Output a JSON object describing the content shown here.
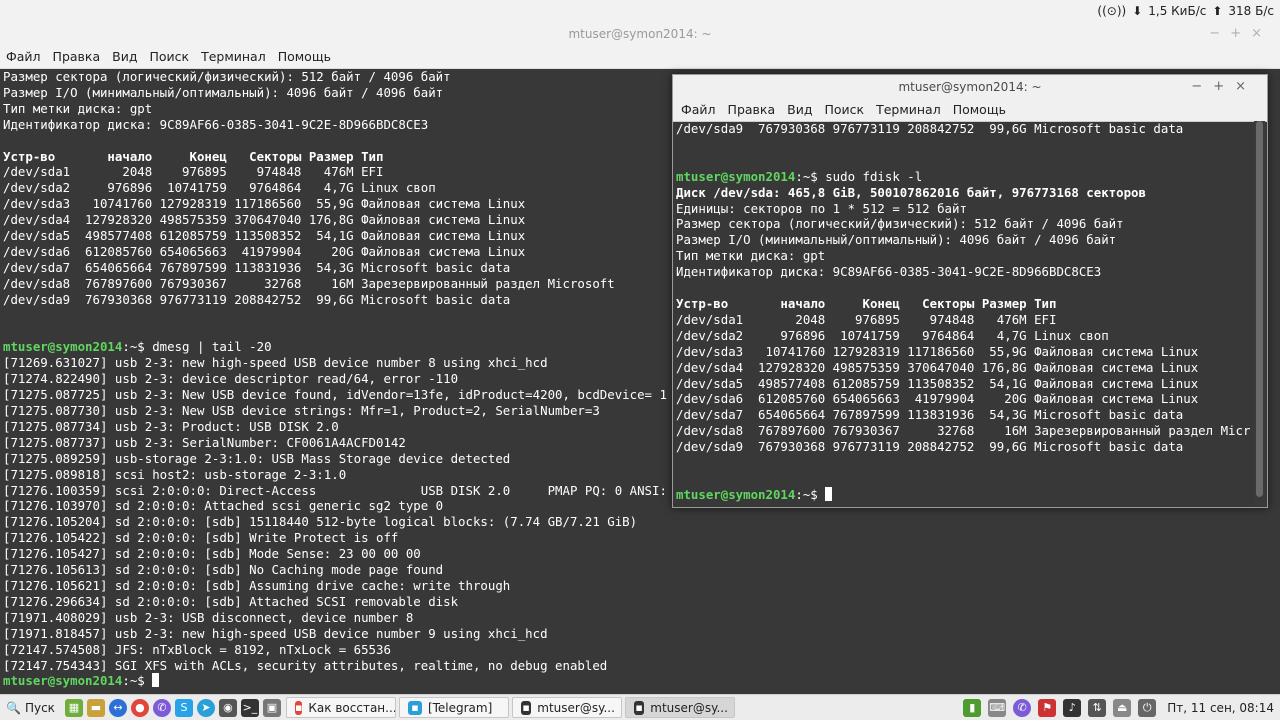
{
  "top_status": {
    "net_icon": "network-icon",
    "down_speed": "1,5 КиБ/с",
    "up_speed": "318 Б/с"
  },
  "win1": {
    "title": "mtuser@symon2014: ~",
    "menu": [
      "Файл",
      "Правка",
      "Вид",
      "Поиск",
      "Терминал",
      "Помощь"
    ],
    "lines_head": [
      "Размер сектора (логический/физический): 512 байт / 4096 байт",
      "Размер I/O (минимальный/оптимальный): 4096 байт / 4096 байт",
      "Тип метки диска: gpt",
      "Идентификатор диска: 9C89AF66-0385-3041-9C2E-8D966BDC8CE3",
      ""
    ],
    "table_header": "Устр-во       начало     Конец   Секторы Размер Тип",
    "table_rows": [
      "/dev/sda1       2048    976895    974848   476M EFI",
      "/dev/sda2     976896  10741759   9764864   4,7G Linux своп",
      "/dev/sda3   10741760 127928319 117186560  55,9G Файловая система Linux",
      "/dev/sda4  127928320 498575359 370647040 176,8G Файловая система Linux",
      "/dev/sda5  498577408 612085759 113508352  54,1G Файловая система Linux",
      "/dev/sda6  612085760 654065663  41979904    20G Файловая система Linux",
      "/dev/sda7  654065664 767897599 113831936  54,3G Microsoft basic data",
      "/dev/sda8  767897600 767930367     32768    16M Зарезервированный раздел Microsoft",
      "/dev/sda9  767930368 976773119 208842752  99,6G Microsoft basic data"
    ],
    "prompt": "mtuser@symon2014",
    "cmd_dmesg": ":~$ dmesg | tail -20",
    "dmesg": [
      "[71269.631027] usb 2-3: new high-speed USB device number 8 using xhci_hcd",
      "[71274.822490] usb 2-3: device descriptor read/64, error -110",
      "[71275.087725] usb 2-3: New USB device found, idVendor=13fe, idProduct=4200, bcdDevice= 1",
      "[71275.087730] usb 2-3: New USB device strings: Mfr=1, Product=2, SerialNumber=3",
      "[71275.087734] usb 2-3: Product: USB DISK 2.0",
      "[71275.087737] usb 2-3: SerialNumber: CF0061A4ACFD0142",
      "[71275.089259] usb-storage 2-3:1.0: USB Mass Storage device detected",
      "[71275.089818] scsi host2: usb-storage 2-3:1.0",
      "[71276.100359] scsi 2:0:0:0: Direct-Access              USB DISK 2.0     PMAP PQ: 0 ANSI:",
      "[71276.103970] sd 2:0:0:0: Attached scsi generic sg2 type 0",
      "[71276.105204] sd 2:0:0:0: [sdb] 15118440 512-byte logical blocks: (7.74 GB/7.21 GiB)",
      "[71276.105422] sd 2:0:0:0: [sdb] Write Protect is off",
      "[71276.105427] sd 2:0:0:0: [sdb] Mode Sense: 23 00 00 00",
      "[71276.105613] sd 2:0:0:0: [sdb] No Caching mode page found",
      "[71276.105621] sd 2:0:0:0: [sdb] Assuming drive cache: write through",
      "[71276.296634] sd 2:0:0:0: [sdb] Attached SCSI removable disk",
      "[71971.408029] usb 2-3: USB disconnect, device number 8",
      "[71971.818457] usb 2-3: new high-speed USB device number 9 using xhci_hcd",
      "[72147.574508] JFS: nTxBlock = 8192, nTxLock = 65536",
      "[72147.754343] SGI XFS with ACLs, security attributes, realtime, no debug enabled"
    ],
    "final_prompt_suffix": ":~$"
  },
  "win2": {
    "title": "mtuser@symon2014: ~",
    "menu": [
      "Файл",
      "Правка",
      "Вид",
      "Поиск",
      "Терминал",
      "Помощь"
    ],
    "first_line": "/dev/sda9  767930368 976773119 208842752  99,6G Microsoft basic data",
    "prompt": "mtuser@symon2014",
    "cmd": ":~$ sudo fdisk -l",
    "disk_line": "Диск /dev/sda: 465,8 GiB, 500107862016 байт, 976773168 секторов",
    "info_lines": [
      "Единицы: секторов по 1 * 512 = 512 байт",
      "Размер сектора (логический/физический): 512 байт / 4096 байт",
      "Размер I/O (минимальный/оптимальный): 4096 байт / 4096 байт",
      "Тип метки диска: gpt",
      "Идентификатор диска: 9C89AF66-0385-3041-9C2E-8D966BDC8CE3"
    ],
    "table_header": "Устр-во       начало     Конец   Секторы Размер Тип",
    "table_rows": [
      "/dev/sda1       2048    976895    974848   476M EFI",
      "/dev/sda2     976896  10741759   9764864   4,7G Linux своп",
      "/dev/sda3   10741760 127928319 117186560  55,9G Файловая система Linux",
      "/dev/sda4  127928320 498575359 370647040 176,8G Файловая система Linux",
      "/dev/sda5  498577408 612085759 113508352  54,1G Файловая система Linux",
      "/dev/sda6  612085760 654065663  41979904    20G Файловая система Linux",
      "/dev/sda7  654065664 767897599 113831936  54,3G Microsoft basic data",
      "/dev/sda8  767897600 767930367     32768    16M Зарезервированный раздел Micr",
      "/dev/sda9  767930368 976773119 208842752  99,6G Microsoft basic data"
    ],
    "final_prompt_suffix": ":~$"
  },
  "taskbar": {
    "start_label": "Пуск",
    "tasks": [
      {
        "label": "Как восстан...",
        "icon": "chrome-icon"
      },
      {
        "label": "[Telegram]",
        "icon": "telegram-icon"
      },
      {
        "label": "mtuser@sy...",
        "icon": "terminal-icon"
      },
      {
        "label": "mtuser@sy...",
        "icon": "terminal-icon"
      }
    ],
    "clock": "Пт, 11 сен, 08:14"
  }
}
